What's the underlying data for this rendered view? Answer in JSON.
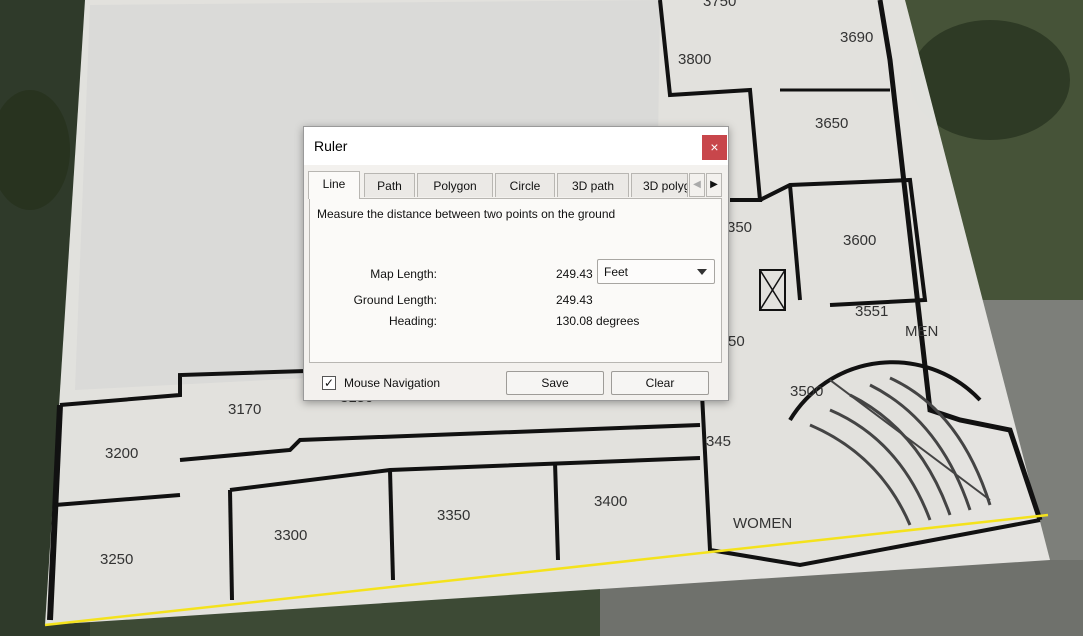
{
  "map": {
    "rooms": [
      "3750",
      "3800",
      "3690",
      "3650",
      "3600",
      "350",
      "3551",
      "MEN",
      "50",
      "3500",
      "3170",
      "3150",
      "3200",
      "3250",
      "3300",
      "3350",
      "3400",
      "345",
      "WOMEN"
    ]
  },
  "dialog": {
    "title": "Ruler",
    "close_label": "×",
    "tabs": [
      "Line",
      "Path",
      "Polygon",
      "Circle",
      "3D path",
      "3D polygon"
    ],
    "tab_prev_icon": "◀",
    "tab_next_icon": "▶",
    "description": "Measure the distance between two points on the ground",
    "map_length_label": "Map Length:",
    "map_length_value": "249.43",
    "unit": "Feet",
    "ground_length_label": "Ground Length:",
    "ground_length_value": "249.43",
    "heading_label": "Heading:",
    "heading_value": "130.08 degrees",
    "mouse_nav_label": "Mouse Navigation",
    "mouse_nav_checked": "✓",
    "save_label": "Save",
    "clear_label": "Clear"
  }
}
